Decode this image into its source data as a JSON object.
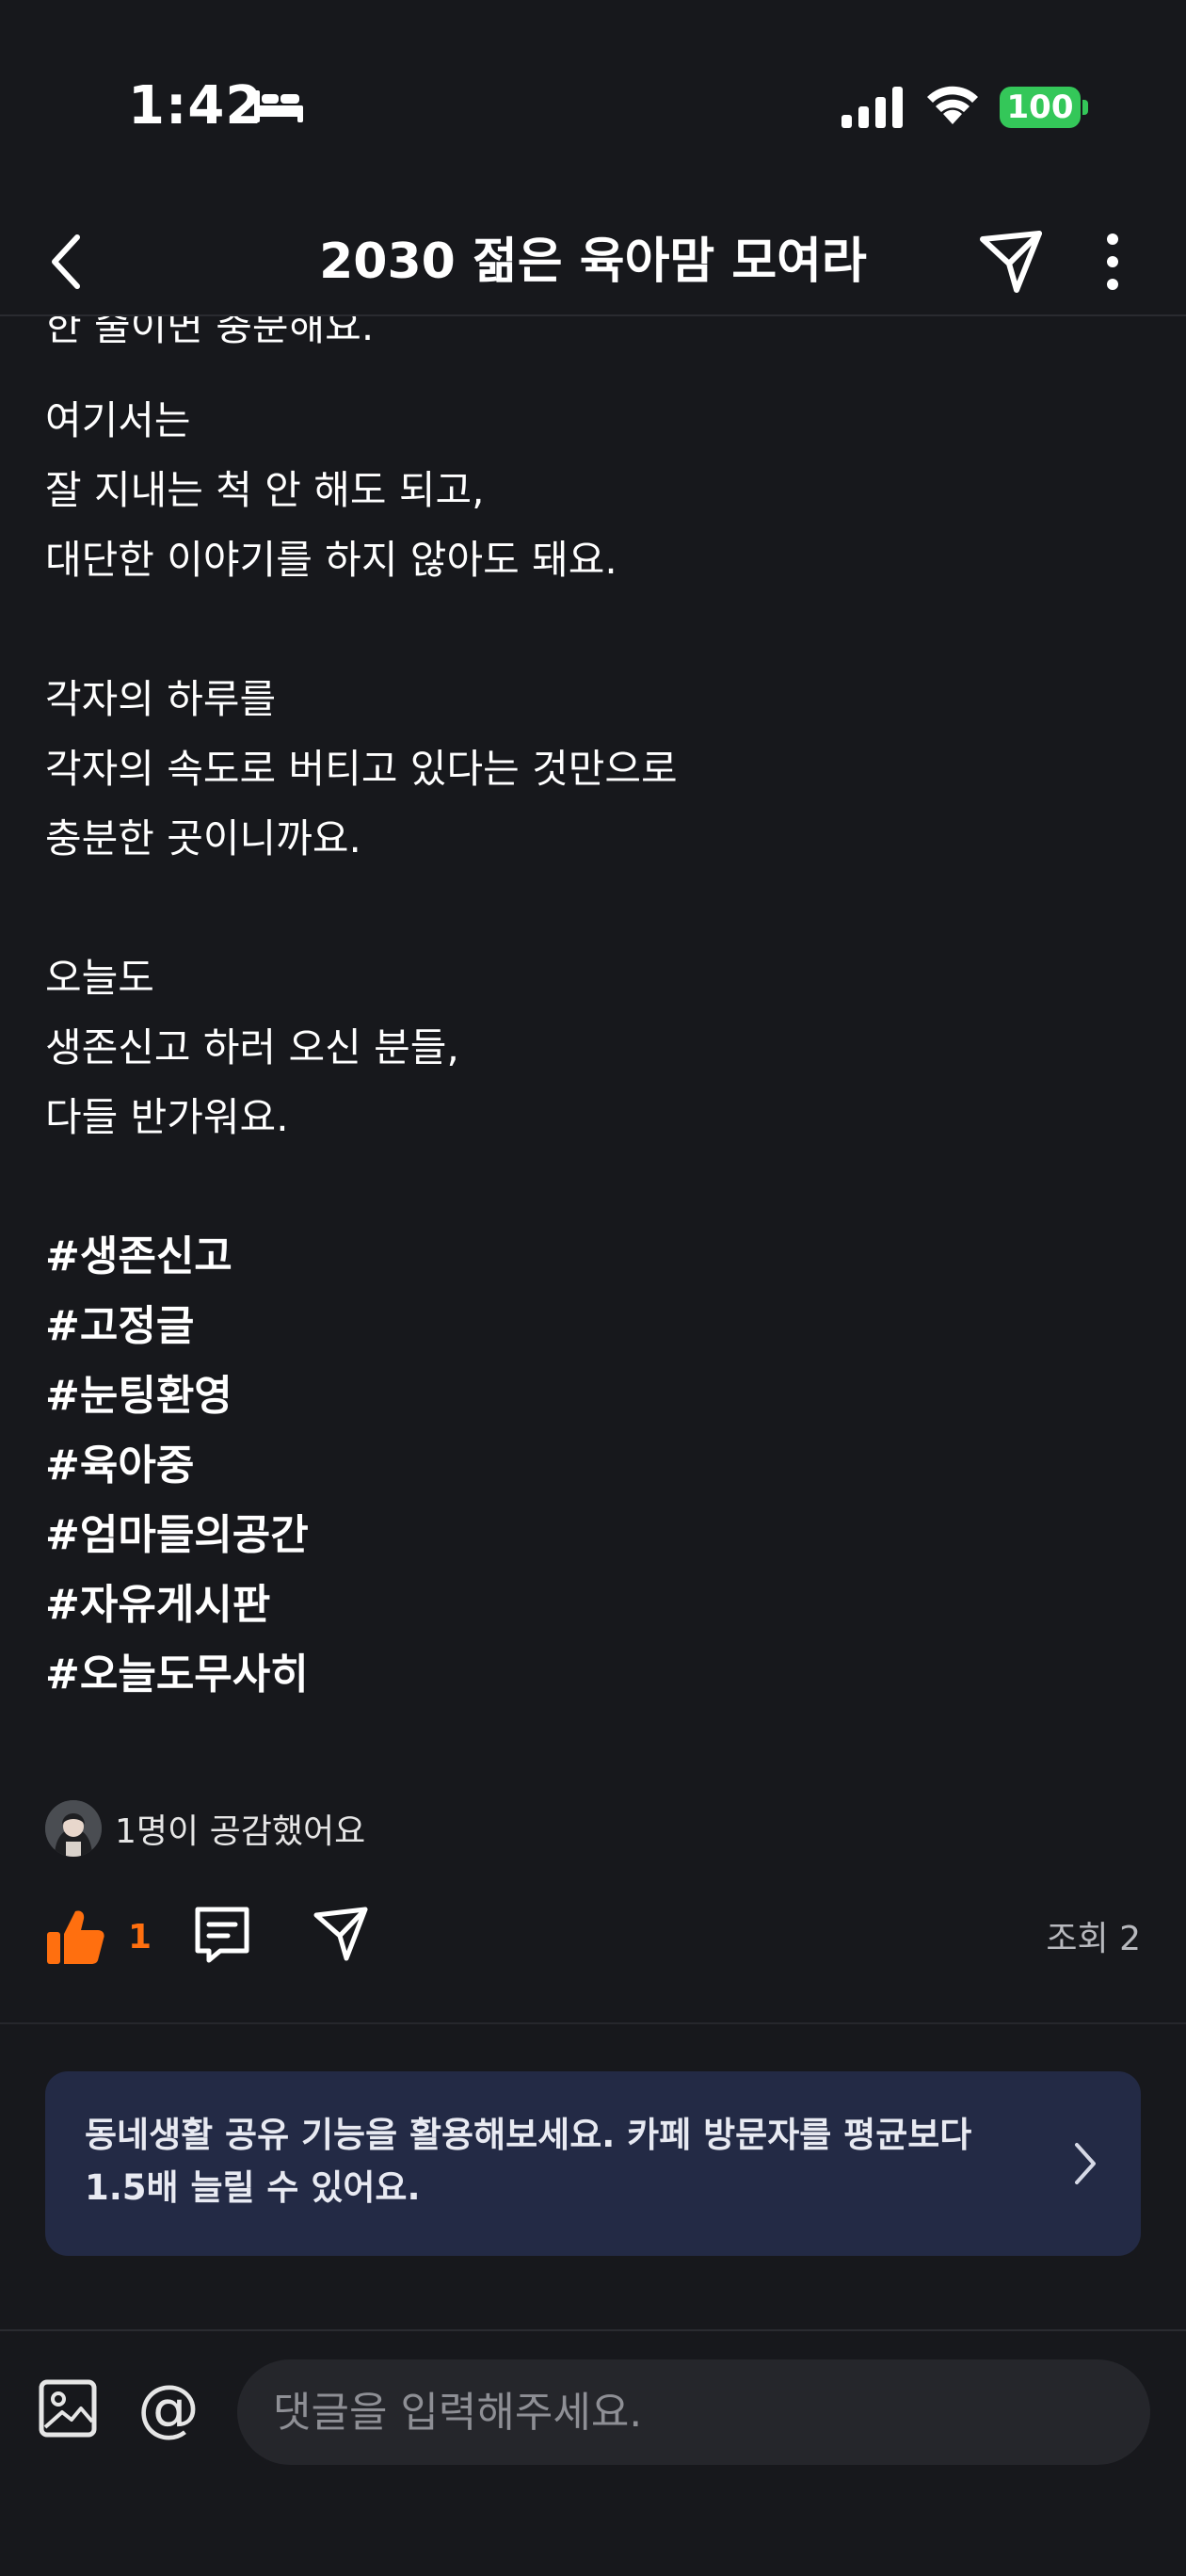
{
  "status_bar": {
    "time": "1:42",
    "battery": "100",
    "colors": {
      "battery": "#34c759"
    }
  },
  "header": {
    "title": "2030 젊은 육아맘 모여라"
  },
  "post": {
    "cut_line": "한 줄이면 충분해요.",
    "lines": [
      "여기서는",
      "잘 지내는 척 안 해도 되고,",
      "대단한 이야기를 하지 않아도 돼요.",
      "",
      "각자의 하루를",
      "각자의 속도로 버티고 있다는 것만으로",
      "충분한 곳이니까요.",
      "",
      "오늘도",
      "생존신고 하러 오신 분들,",
      "다들 반가워요.",
      ""
    ],
    "tags": [
      "#생존신고",
      "#고정글",
      "#눈팅환영",
      "#육아중",
      "#엄마들의공간",
      "#자유게시판",
      "#오늘도무사히"
    ]
  },
  "empathy": {
    "text": "1명이 공감했어요"
  },
  "actions": {
    "like_count": "1",
    "view_count": "조회 2",
    "colors": {
      "like": "#ff6f0f"
    }
  },
  "banner": {
    "text": "동네생활 공유 기능을 활용해보세요. 카페 방문자를 평균보다 1.5배 늘릴 수 있어요.",
    "background": "#232a45"
  },
  "comment_bar": {
    "mention_symbol": "@",
    "placeholder": "댓글을 입력해주세요."
  },
  "icons": [
    "bed-icon",
    "signal-icon",
    "wifi-icon",
    "back-icon",
    "send-icon",
    "more-icon",
    "thumbs-up-icon",
    "comment-icon",
    "chevron-right-icon",
    "image-icon"
  ]
}
